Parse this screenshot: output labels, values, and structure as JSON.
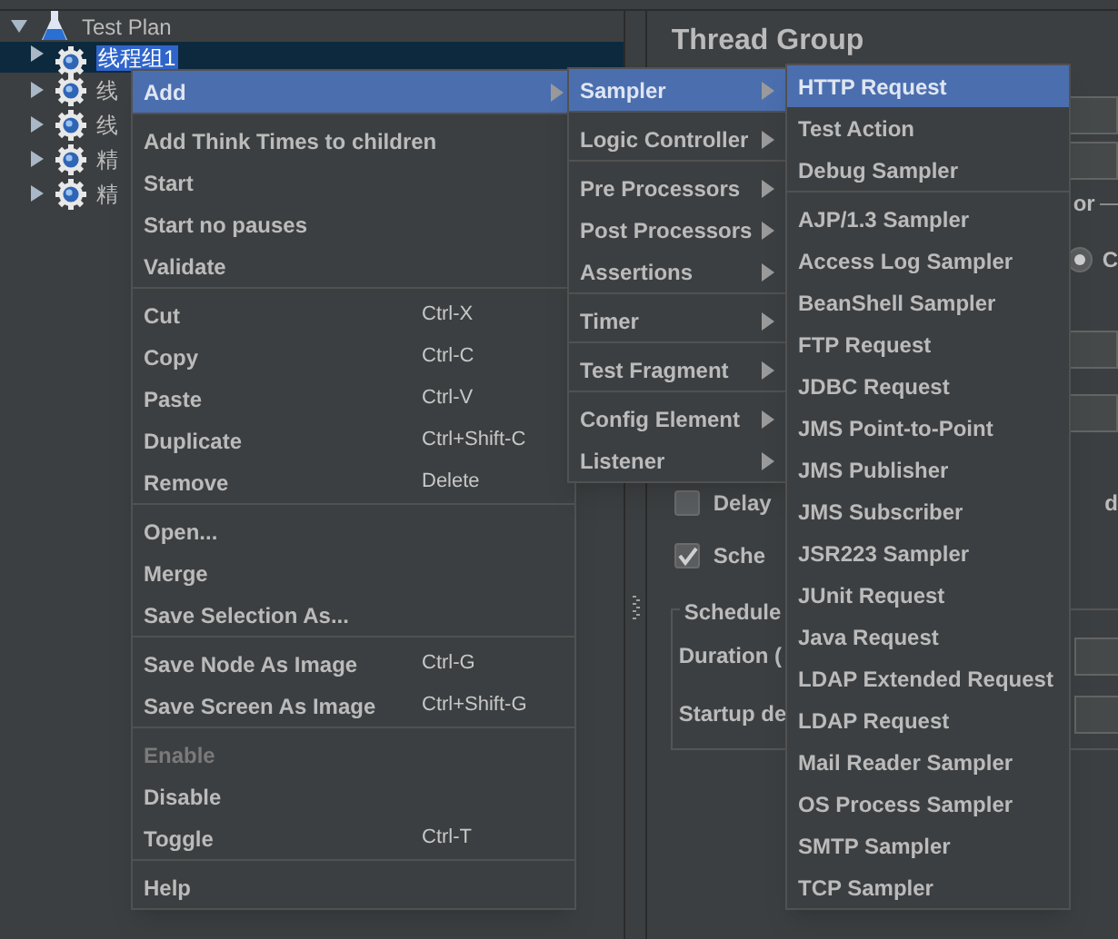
{
  "tree": {
    "label": "Test Plan",
    "expanded": true,
    "children": [
      {
        "label": "线程组1",
        "selected": true,
        "expanded": false
      },
      {
        "label": "线",
        "selected": false,
        "expanded": false
      },
      {
        "label": "线",
        "selected": false,
        "expanded": false
      },
      {
        "label": "精",
        "selected": false,
        "expanded": false
      },
      {
        "label": "精",
        "selected": false,
        "expanded": false
      }
    ]
  },
  "panel": {
    "title": "Thread Group",
    "error_group_label": "or",
    "action_option": {
      "label": "C",
      "selected": true
    },
    "delay_option": {
      "label": "Delay",
      "checked": false
    },
    "delay_tail": "d",
    "scheduler_option": {
      "label": "Sche",
      "checked": true
    },
    "schedule_group": {
      "label": "Schedule",
      "fields": [
        {
          "label": "Duration ("
        },
        {
          "label": "Startup de"
        }
      ]
    }
  },
  "context_menu": {
    "sections": [
      [
        {
          "label": "Add",
          "submenu": true,
          "selected": true,
          "disabled": false
        }
      ],
      [
        {
          "label": "Add Think Times to children",
          "submenu": false,
          "selected": false,
          "disabled": false
        },
        {
          "label": "Start",
          "submenu": false,
          "selected": false,
          "disabled": false
        },
        {
          "label": "Start no pauses",
          "submenu": false,
          "selected": false,
          "disabled": false
        },
        {
          "label": "Validate",
          "submenu": false,
          "selected": false,
          "disabled": false
        }
      ],
      [
        {
          "label": "Cut",
          "shortcut": "Ctrl-X",
          "submenu": false,
          "selected": false,
          "disabled": false
        },
        {
          "label": "Copy",
          "shortcut": "Ctrl-C",
          "submenu": false,
          "selected": false,
          "disabled": false
        },
        {
          "label": "Paste",
          "shortcut": "Ctrl-V",
          "submenu": false,
          "selected": false,
          "disabled": false
        },
        {
          "label": "Duplicate",
          "shortcut": "Ctrl+Shift-C",
          "submenu": false,
          "selected": false,
          "disabled": false
        },
        {
          "label": "Remove",
          "shortcut": "Delete",
          "submenu": false,
          "selected": false,
          "disabled": false
        }
      ],
      [
        {
          "label": "Open...",
          "submenu": false,
          "selected": false,
          "disabled": false
        },
        {
          "label": "Merge",
          "submenu": false,
          "selected": false,
          "disabled": false
        },
        {
          "label": "Save Selection As...",
          "submenu": false,
          "selected": false,
          "disabled": false
        }
      ],
      [
        {
          "label": "Save Node As Image",
          "shortcut": "Ctrl-G",
          "submenu": false,
          "selected": false,
          "disabled": false
        },
        {
          "label": "Save Screen As Image",
          "shortcut": "Ctrl+Shift-G",
          "submenu": false,
          "selected": false,
          "disabled": false
        }
      ],
      [
        {
          "label": "Enable",
          "submenu": false,
          "selected": false,
          "disabled": true
        },
        {
          "label": "Disable",
          "submenu": false,
          "selected": false,
          "disabled": false
        },
        {
          "label": "Toggle",
          "shortcut": "Ctrl-T",
          "submenu": false,
          "selected": false,
          "disabled": false
        }
      ],
      [
        {
          "label": "Help",
          "submenu": false,
          "selected": false,
          "disabled": false
        }
      ]
    ]
  },
  "add_submenu": {
    "sections": [
      [
        {
          "label": "Sampler",
          "submenu": true,
          "selected": true
        }
      ],
      [
        {
          "label": "Logic Controller",
          "submenu": true,
          "selected": false
        }
      ],
      [
        {
          "label": "Pre Processors",
          "submenu": true,
          "selected": false
        },
        {
          "label": "Post Processors",
          "submenu": true,
          "selected": false
        },
        {
          "label": "Assertions",
          "submenu": true,
          "selected": false
        }
      ],
      [
        {
          "label": "Timer",
          "submenu": true,
          "selected": false
        }
      ],
      [
        {
          "label": "Test Fragment",
          "submenu": true,
          "selected": false
        }
      ],
      [
        {
          "label": "Config Element",
          "submenu": true,
          "selected": false
        },
        {
          "label": "Listener",
          "submenu": true,
          "selected": false
        }
      ]
    ]
  },
  "sampler_submenu": {
    "sections": [
      [
        {
          "label": "HTTP Request",
          "submenu": false,
          "selected": true
        },
        {
          "label": "Test Action",
          "submenu": false,
          "selected": false
        },
        {
          "label": "Debug Sampler",
          "submenu": false,
          "selected": false
        }
      ],
      [
        {
          "label": "AJP/1.3 Sampler",
          "submenu": false,
          "selected": false
        },
        {
          "label": "Access Log Sampler",
          "submenu": false,
          "selected": false
        },
        {
          "label": "BeanShell Sampler",
          "submenu": false,
          "selected": false
        },
        {
          "label": "FTP Request",
          "submenu": false,
          "selected": false
        },
        {
          "label": "JDBC Request",
          "submenu": false,
          "selected": false
        },
        {
          "label": "JMS Point-to-Point",
          "submenu": false,
          "selected": false
        },
        {
          "label": "JMS Publisher",
          "submenu": false,
          "selected": false
        },
        {
          "label": "JMS Subscriber",
          "submenu": false,
          "selected": false
        },
        {
          "label": "JSR223 Sampler",
          "submenu": false,
          "selected": false
        },
        {
          "label": "JUnit Request",
          "submenu": false,
          "selected": false
        },
        {
          "label": "Java Request",
          "submenu": false,
          "selected": false
        },
        {
          "label": "LDAP Extended Request",
          "submenu": false,
          "selected": false
        },
        {
          "label": "LDAP Request",
          "submenu": false,
          "selected": false
        },
        {
          "label": "Mail Reader Sampler",
          "submenu": false,
          "selected": false
        },
        {
          "label": "OS Process Sampler",
          "submenu": false,
          "selected": false
        },
        {
          "label": "SMTP Sampler",
          "submenu": false,
          "selected": false
        },
        {
          "label": "TCP Sampler",
          "submenu": false,
          "selected": false
        }
      ]
    ]
  }
}
